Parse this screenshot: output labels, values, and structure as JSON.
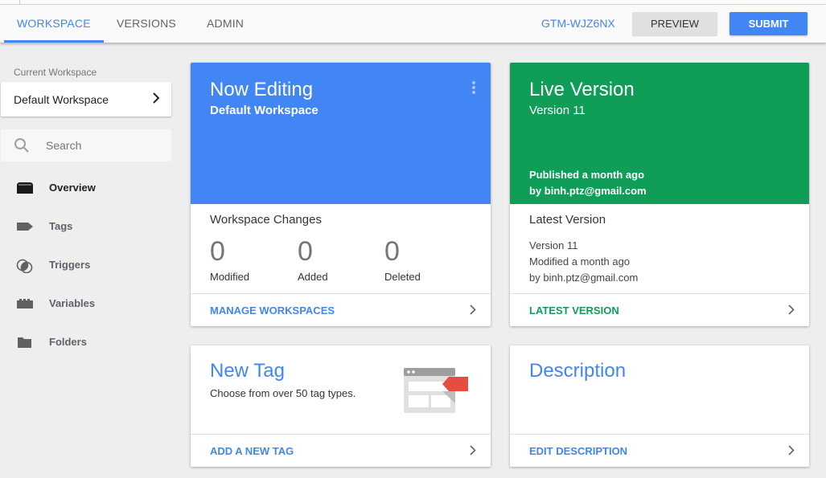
{
  "header": {
    "tabs": [
      {
        "label": "WORKSPACE",
        "active": true
      },
      {
        "label": "VERSIONS",
        "active": false
      },
      {
        "label": "ADMIN",
        "active": false
      }
    ],
    "container_id": "GTM-WJZ6NX",
    "preview_label": "PREVIEW",
    "submit_label": "SUBMIT"
  },
  "sidebar": {
    "current_workspace_label": "Current Workspace",
    "current_workspace": "Default Workspace",
    "search_placeholder": "Search",
    "items": [
      {
        "label": "Overview",
        "icon": "overview-icon",
        "active": true
      },
      {
        "label": "Tags",
        "icon": "tag-icon",
        "active": false
      },
      {
        "label": "Triggers",
        "icon": "trigger-icon",
        "active": false
      },
      {
        "label": "Variables",
        "icon": "variable-icon",
        "active": false
      },
      {
        "label": "Folders",
        "icon": "folder-icon",
        "active": false
      }
    ]
  },
  "now_editing": {
    "title": "Now Editing",
    "workspace": "Default Workspace",
    "changes_title": "Workspace Changes",
    "stats": [
      {
        "value": "0",
        "label": "Modified"
      },
      {
        "value": "0",
        "label": "Added"
      },
      {
        "value": "0",
        "label": "Deleted"
      }
    ],
    "footer_link": "MANAGE WORKSPACES",
    "color": "#4285f4"
  },
  "live_version": {
    "title": "Live Version",
    "version": "Version 11",
    "published": "Published a month ago",
    "by": "by binh.ptz@gmail.com",
    "latest_title": "Latest Version",
    "latest_version": "Version 11",
    "latest_modified": "Modified a month ago",
    "latest_by": "by binh.ptz@gmail.com",
    "footer_link": "LATEST VERSION",
    "color": "#0f9d58"
  },
  "new_tag": {
    "title": "New Tag",
    "description": "Choose from over 50 tag types.",
    "footer_link": "ADD A NEW TAG"
  },
  "description_card": {
    "title": "Description",
    "footer_link": "EDIT DESCRIPTION"
  }
}
